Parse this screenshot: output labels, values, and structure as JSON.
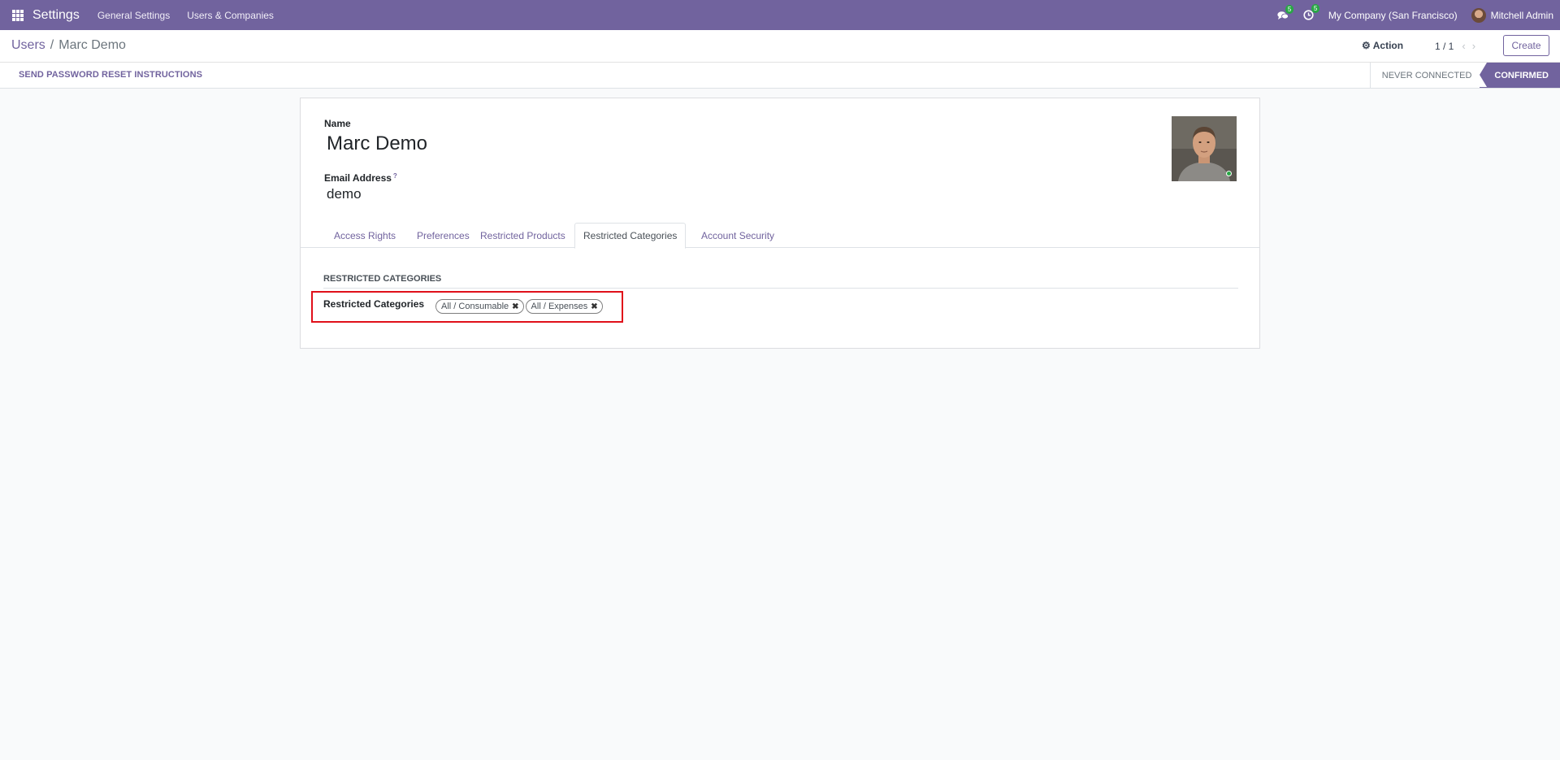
{
  "navbar": {
    "app_name": "Settings",
    "menus": [
      "General Settings",
      "Users & Companies"
    ],
    "messages_count": "5",
    "activities_count": "5",
    "company": "My Company (San Francisco)",
    "user": "Mitchell Admin",
    "accent_color": "#71639e"
  },
  "control_panel": {
    "breadcrumb_parent": "Users",
    "breadcrumb_separator": "/",
    "breadcrumb_current": "Marc Demo",
    "action_label": "Action",
    "pager": "1 / 1",
    "create_label": "Create"
  },
  "statusbar": {
    "reset_button": "SEND PASSWORD RESET INSTRUCTIONS",
    "stages": [
      "NEVER CONNECTED",
      "CONFIRMED"
    ],
    "active_stage": "CONFIRMED"
  },
  "form": {
    "name_label": "Name",
    "name_value": "Marc Demo",
    "email_label": "Email Address",
    "email_help": "?",
    "email_value": "demo",
    "tabs": [
      "Access Rights",
      "Preferences",
      "Restricted Products",
      "Restricted Categories",
      "Account Security"
    ],
    "active_tab": "Restricted Categories",
    "group_title": "RESTRICTED CATEGORIES",
    "restricted_categories_label": "Restricted Categories",
    "restricted_categories": [
      "All / Consumable",
      "All / Expenses"
    ]
  }
}
